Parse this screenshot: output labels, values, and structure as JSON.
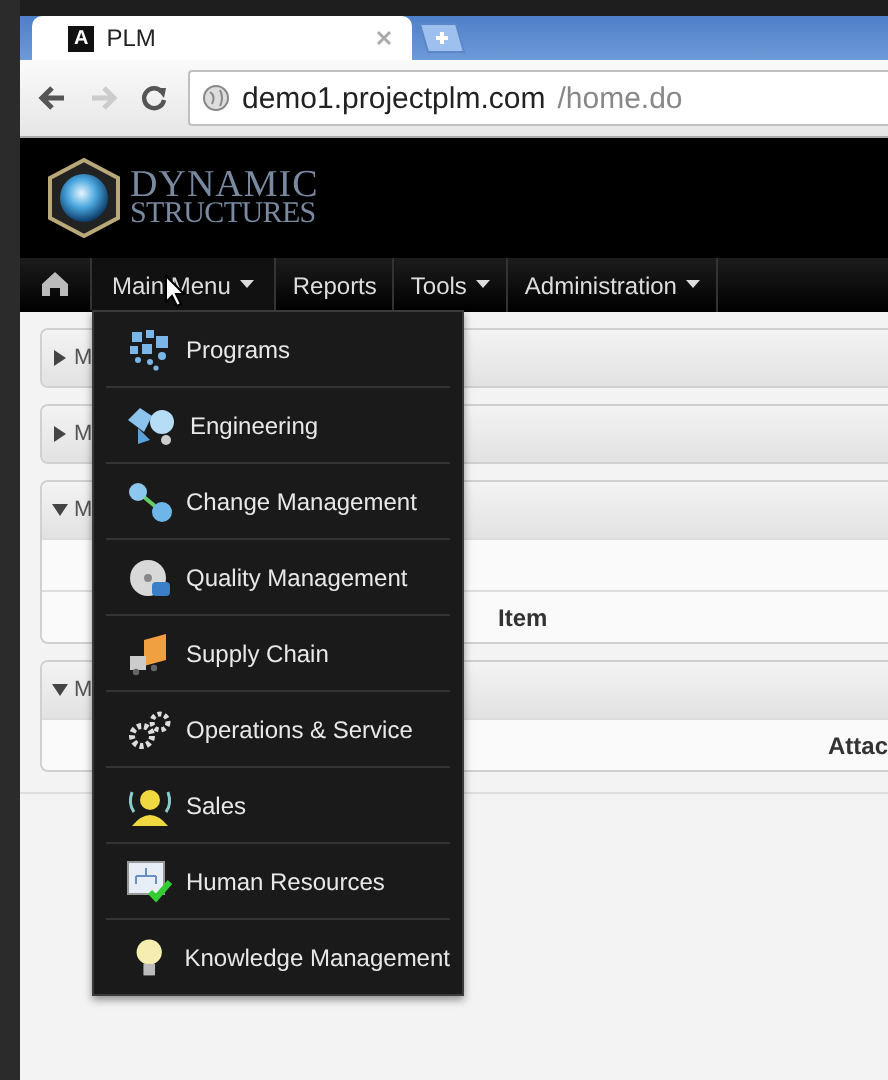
{
  "browser": {
    "tab_title": "PLM",
    "favicon": "A",
    "url_host": "demo1.projectplm.com",
    "url_path": "/home.do"
  },
  "logo": {
    "line1": "DYNAMIC",
    "line2": "STRUCTURES"
  },
  "nav": [
    {
      "label": "Main Menu",
      "dropdown": true,
      "expanded": true
    },
    {
      "label": "Reports",
      "dropdown": false,
      "expanded": false
    },
    {
      "label": "Tools",
      "dropdown": true,
      "expanded": false
    },
    {
      "label": "Administration",
      "dropdown": true,
      "expanded": false
    }
  ],
  "menu": [
    {
      "label": "Programs"
    },
    {
      "label": "Engineering"
    },
    {
      "label": "Change Management"
    },
    {
      "label": "Quality Management"
    },
    {
      "label": "Supply Chain"
    },
    {
      "label": "Operations & Service"
    },
    {
      "label": "Sales"
    },
    {
      "label": "Human Resources"
    },
    {
      "label": "Knowledge Management"
    }
  ],
  "panels": [
    {
      "title": "M",
      "expanded": false
    },
    {
      "title": "M",
      "expanded": false
    },
    {
      "title": "M",
      "expanded": true,
      "column": "Item"
    },
    {
      "title": "M",
      "expanded": true,
      "column": "Attac"
    }
  ]
}
